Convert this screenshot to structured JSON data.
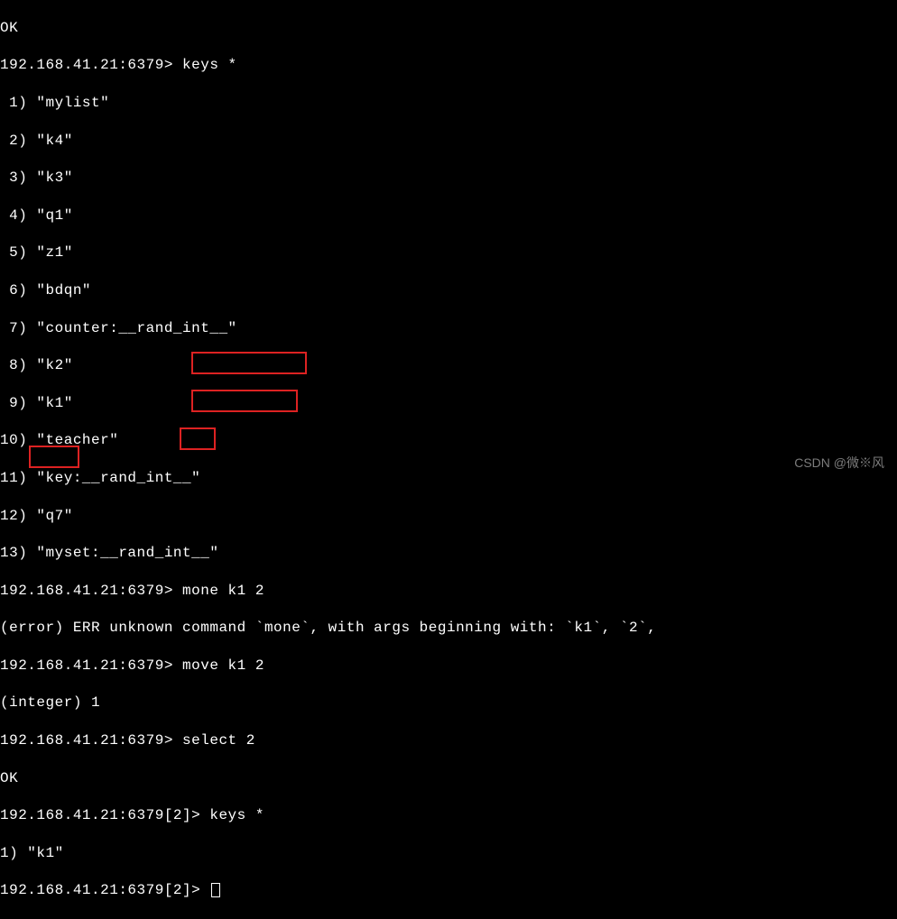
{
  "top_line": "OK",
  "prompt1": "192.168.41.21:6379> keys *",
  "keys_output": [
    " 1) \"mylist\"",
    " 2) \"k4\"",
    " 3) \"k3\"",
    " 4) \"q1\"",
    " 5) \"z1\"",
    " 6) \"bdqn\"",
    " 7) \"counter:__rand_int__\"",
    " 8) \"k2\"",
    " 9) \"k1\"",
    "10) \"teacher\"",
    "11) \"key:__rand_int__\"",
    "12) \"q7\"",
    "13) \"myset:__rand_int__\""
  ],
  "prompt2": "192.168.41.21:6379> mone k1 2",
  "error_line": "(error) ERR unknown command `mone`, with args beginning with: `k1`, `2`,",
  "prompt3": "192.168.41.21:6379> move k1 2",
  "int_line": "(integer) 1",
  "prompt4": "192.168.41.21:6379> select 2",
  "ok_line": "OK",
  "prompt5": "192.168.41.21:6379[2]> keys *",
  "result_line": "1) \"k1\"",
  "prompt6": "192.168.41.21:6379[2]> ",
  "watermark": "CSDN @微※风"
}
